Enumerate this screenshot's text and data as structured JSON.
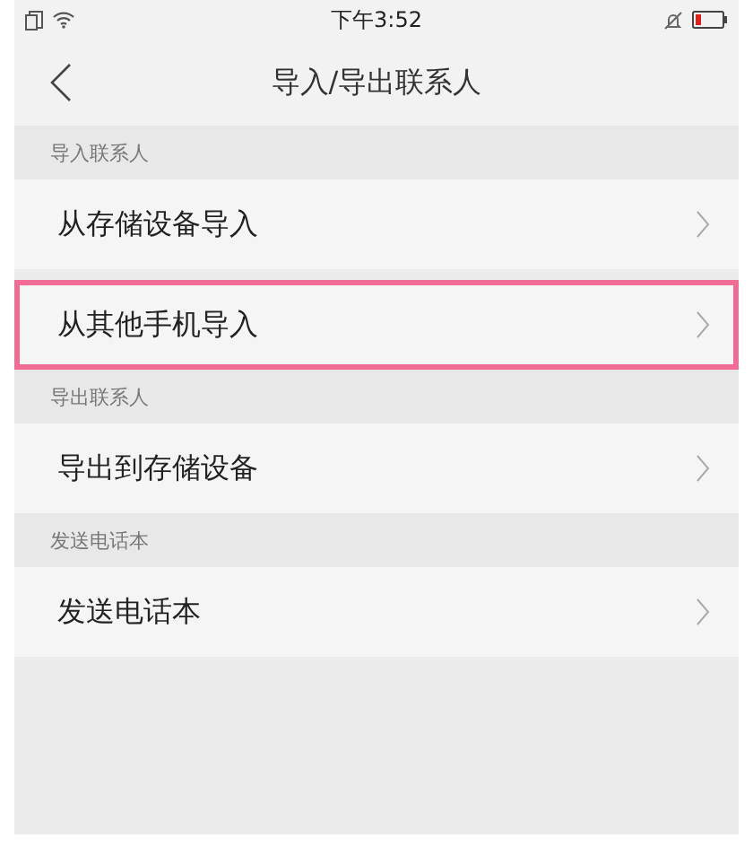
{
  "status_bar": {
    "time": "下午3:52"
  },
  "header": {
    "title": "导入/导出联系人"
  },
  "sections": [
    {
      "label": "导入联系人",
      "items": [
        {
          "label": "从存储设备导入",
          "highlighted": false
        },
        {
          "label": "从其他手机导入",
          "highlighted": true
        }
      ]
    },
    {
      "label": "导出联系人",
      "items": [
        {
          "label": "导出到存储设备",
          "highlighted": false
        }
      ]
    },
    {
      "label": "发送电话本",
      "items": [
        {
          "label": "发送电话本",
          "highlighted": false
        }
      ]
    }
  ]
}
